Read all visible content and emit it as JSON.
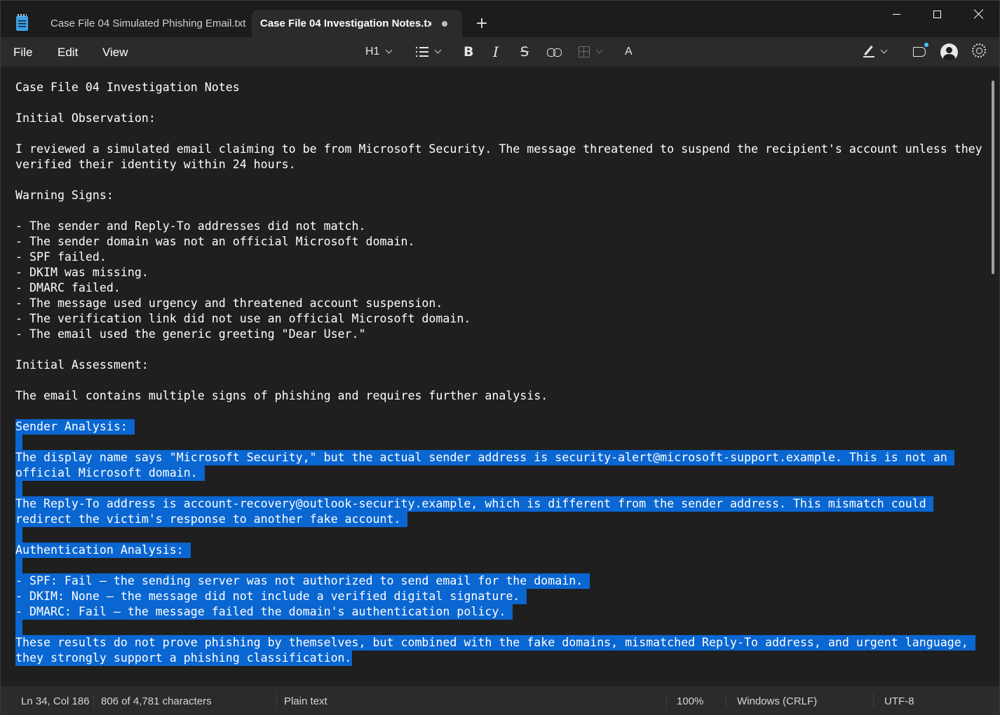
{
  "tabs": [
    {
      "label": "Case File 04 Simulated Phishing Email.txt"
    },
    {
      "label": "Case File 04 Investigation Notes.txt"
    }
  ],
  "new_tab_label": "+",
  "menu": {
    "file": "File",
    "edit": "Edit",
    "view": "View"
  },
  "toolbar": {
    "heading": "H1",
    "bold": "B",
    "italic": "I",
    "strikethrough": "S",
    "spellcheck": "A"
  },
  "colors": {
    "selection": "#0a66d1",
    "accent": "#4cc2ff",
    "background": "#1f1f1f"
  },
  "document": {
    "lines": [
      {
        "text": "Case File 04 Investigation Notes",
        "selected": false
      },
      {
        "text": "",
        "selected": false
      },
      {
        "text": "Initial Observation:",
        "selected": false
      },
      {
        "text": "",
        "selected": false
      },
      {
        "text": "I reviewed a simulated email claiming to be from Microsoft Security. The message threatened to suspend the recipient's account unless they",
        "selected": false
      },
      {
        "text": "verified their identity within 24 hours.",
        "selected": false
      },
      {
        "text": "",
        "selected": false
      },
      {
        "text": "Warning Signs:",
        "selected": false
      },
      {
        "text": "",
        "selected": false
      },
      {
        "text": "- The sender and Reply-To addresses did not match.",
        "selected": false
      },
      {
        "text": "- The sender domain was not an official Microsoft domain.",
        "selected": false
      },
      {
        "text": "- SPF failed.",
        "selected": false
      },
      {
        "text": "- DKIM was missing.",
        "selected": false
      },
      {
        "text": "- DMARC failed.",
        "selected": false
      },
      {
        "text": "- The message used urgency and threatened account suspension.",
        "selected": false
      },
      {
        "text": "- The verification link did not use an official Microsoft domain.",
        "selected": false
      },
      {
        "text": "- The email used the generic greeting \"Dear User.\"",
        "selected": false
      },
      {
        "text": "",
        "selected": false
      },
      {
        "text": "Initial Assessment:",
        "selected": false
      },
      {
        "text": "",
        "selected": false
      },
      {
        "text": "The email contains multiple signs of phishing and requires further analysis.",
        "selected": false
      },
      {
        "text": "",
        "selected": false
      },
      {
        "text": "Sender Analysis: ",
        "selected": true
      },
      {
        "text": "",
        "selected": true
      },
      {
        "text": "The display name says \"Microsoft Security,\" but the actual sender address is security-alert@microsoft-support.example. This is not an ",
        "selected": true
      },
      {
        "text": "official Microsoft domain. ",
        "selected": true
      },
      {
        "text": "",
        "selected": true
      },
      {
        "text": "The Reply-To address is account-recovery@outlook-security.example, which is different from the sender address. This mismatch could ",
        "selected": true
      },
      {
        "text": "redirect the victim's response to another fake account. ",
        "selected": true
      },
      {
        "text": "",
        "selected": true
      },
      {
        "text": "Authentication Analysis: ",
        "selected": true
      },
      {
        "text": "",
        "selected": true
      },
      {
        "text": "- SPF: Fail — the sending server was not authorized to send email for the domain. ",
        "selected": true
      },
      {
        "text": "- DKIM: None — the message did not include a verified digital signature. ",
        "selected": true
      },
      {
        "text": "- DMARC: Fail — the message failed the domain's authentication policy. ",
        "selected": true
      },
      {
        "text": "",
        "selected": true
      },
      {
        "text": "These results do not prove phishing by themselves, but combined with the fake domains, mismatched Reply-To address, and urgent language, ",
        "selected": true
      },
      {
        "text": "they strongly support a phishing classification.",
        "selected": true
      }
    ]
  },
  "status": {
    "position": "Ln 34, Col 186",
    "chars": "806 of 4,781 characters",
    "format": "Plain text",
    "zoom": "100%",
    "line_ending": "Windows (CRLF)",
    "encoding": "UTF-8"
  }
}
